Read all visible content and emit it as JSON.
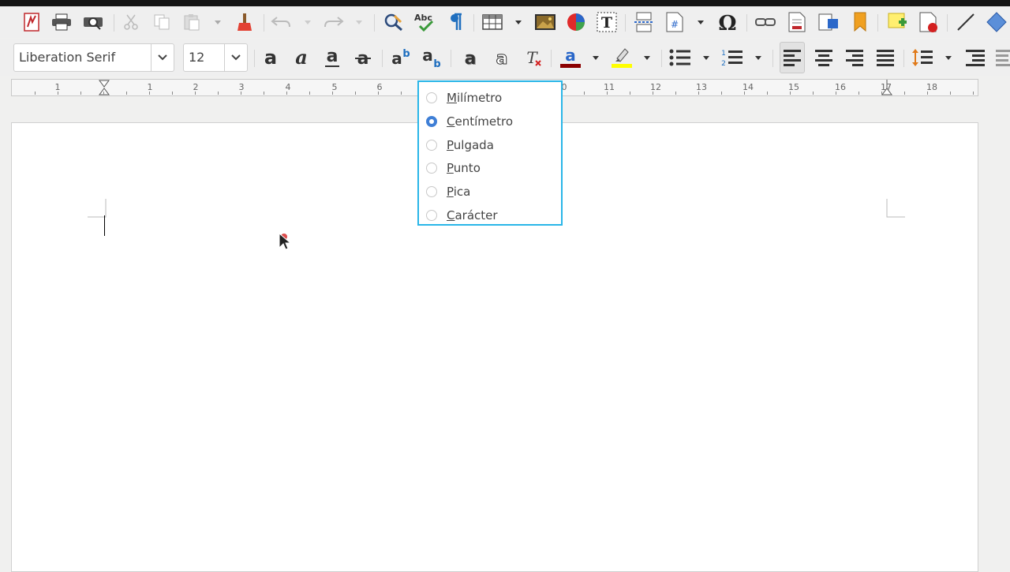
{
  "toolbar_standard": {
    "icons": [
      "pdf-export-icon",
      "print-icon",
      "print-preview-icon",
      "cut-icon",
      "copy-icon",
      "paste-icon",
      "clone-formatting-icon",
      "undo-icon",
      "redo-icon",
      "find-replace-icon",
      "spellcheck-icon",
      "formatting-marks-icon",
      "insert-table-icon",
      "insert-image-icon",
      "insert-chart-icon",
      "insert-textbox-icon",
      "page-break-icon",
      "insert-field-icon",
      "special-character-icon",
      "hyperlink-icon",
      "footnote-icon",
      "endnote-icon",
      "bookmark-icon",
      "comment-icon",
      "track-changes-icon",
      "line-icon",
      "shapes-icon"
    ]
  },
  "toolbar_formatting": {
    "font_name": "Liberation Serif",
    "font_size": "12",
    "font_color": "#8b0000",
    "highlight_color": "#ffff00"
  },
  "ruler": {
    "numbers": [
      "1",
      "1",
      "2",
      "3",
      "4",
      "5",
      "6",
      "0",
      "11",
      "12",
      "13",
      "14",
      "15",
      "16",
      "17",
      "18"
    ]
  },
  "unit_menu": {
    "items": [
      {
        "label": "Milímetro",
        "selected": false
      },
      {
        "label": "Centímetro",
        "selected": true
      },
      {
        "label": "Pulgada",
        "selected": false
      },
      {
        "label": "Punto",
        "selected": false
      },
      {
        "label": "Pica",
        "selected": false
      },
      {
        "label": "Carácter",
        "selected": false
      }
    ]
  },
  "colors": {
    "accent": "#29b6e8",
    "radio_selected": "#3f7fd6"
  }
}
